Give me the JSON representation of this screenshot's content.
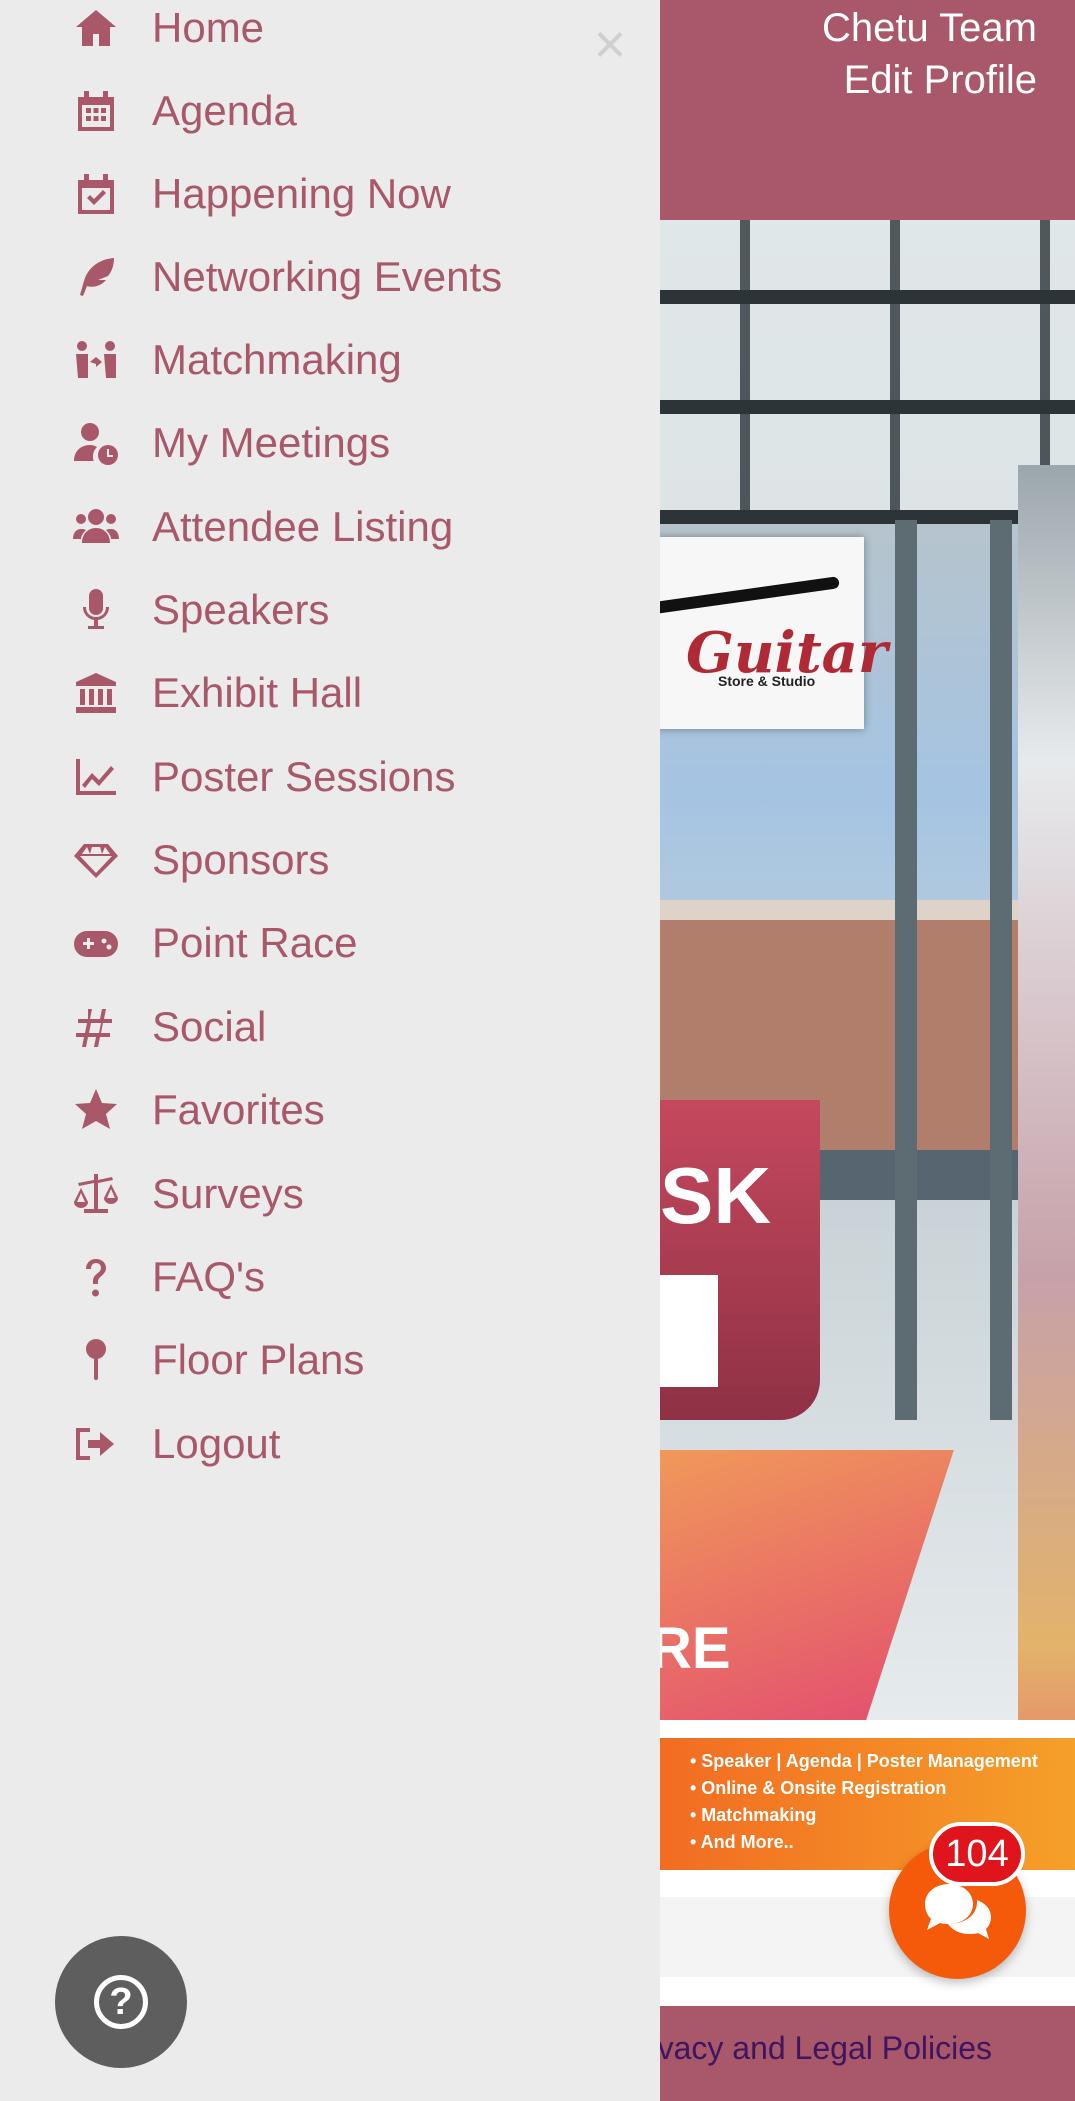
{
  "user": {
    "name": "Chetu Team",
    "edit_profile": "Edit Profile"
  },
  "drawer": {
    "close_icon": "×",
    "items": [
      {
        "label": "Home",
        "icon": "home-icon"
      },
      {
        "label": "Agenda",
        "icon": "calendar-grid-icon"
      },
      {
        "label": "Happening Now",
        "icon": "calendar-check-icon"
      },
      {
        "label": "Networking Events",
        "icon": "feather-icon"
      },
      {
        "label": "Matchmaking",
        "icon": "people-arrows-icon"
      },
      {
        "label": "My Meetings",
        "icon": "user-clock-icon"
      },
      {
        "label": "Attendee Listing",
        "icon": "users-icon"
      },
      {
        "label": "Speakers",
        "icon": "microphone-icon"
      },
      {
        "label": "Exhibit Hall",
        "icon": "landmark-icon"
      },
      {
        "label": "Poster Sessions",
        "icon": "line-chart-icon"
      },
      {
        "label": "Sponsors",
        "icon": "gem-icon"
      },
      {
        "label": "Point Race",
        "icon": "gamepad-icon"
      },
      {
        "label": "Social",
        "icon": "hashtag-icon"
      },
      {
        "label": "Favorites",
        "icon": "star-icon"
      },
      {
        "label": "Surveys",
        "icon": "balance-scale-icon"
      },
      {
        "label": "FAQ's",
        "icon": "question-icon"
      },
      {
        "label": "Floor Plans",
        "icon": "map-pin-icon"
      },
      {
        "label": "Logout",
        "icon": "sign-out-icon"
      }
    ]
  },
  "hero": {
    "sign_brand": "Guitar",
    "sign_sub": "Store & Studio",
    "desk_text": "SK",
    "mat_text": "RE"
  },
  "promo": {
    "items": [
      "• Speaker | Agenda | Poster Management",
      "• Online & Onsite Registration",
      "• Matchmaking",
      "• And More.."
    ]
  },
  "help_button": {
    "glyph": "?"
  },
  "chat": {
    "badge_count": "104"
  },
  "footer": {
    "privacy_text": "vacy and Legal Policies"
  },
  "colors": {
    "brand": "#a85869",
    "drawer_bg": "#ebebeb",
    "chat_fab": "#f45a0a",
    "badge": "#e0141c"
  }
}
